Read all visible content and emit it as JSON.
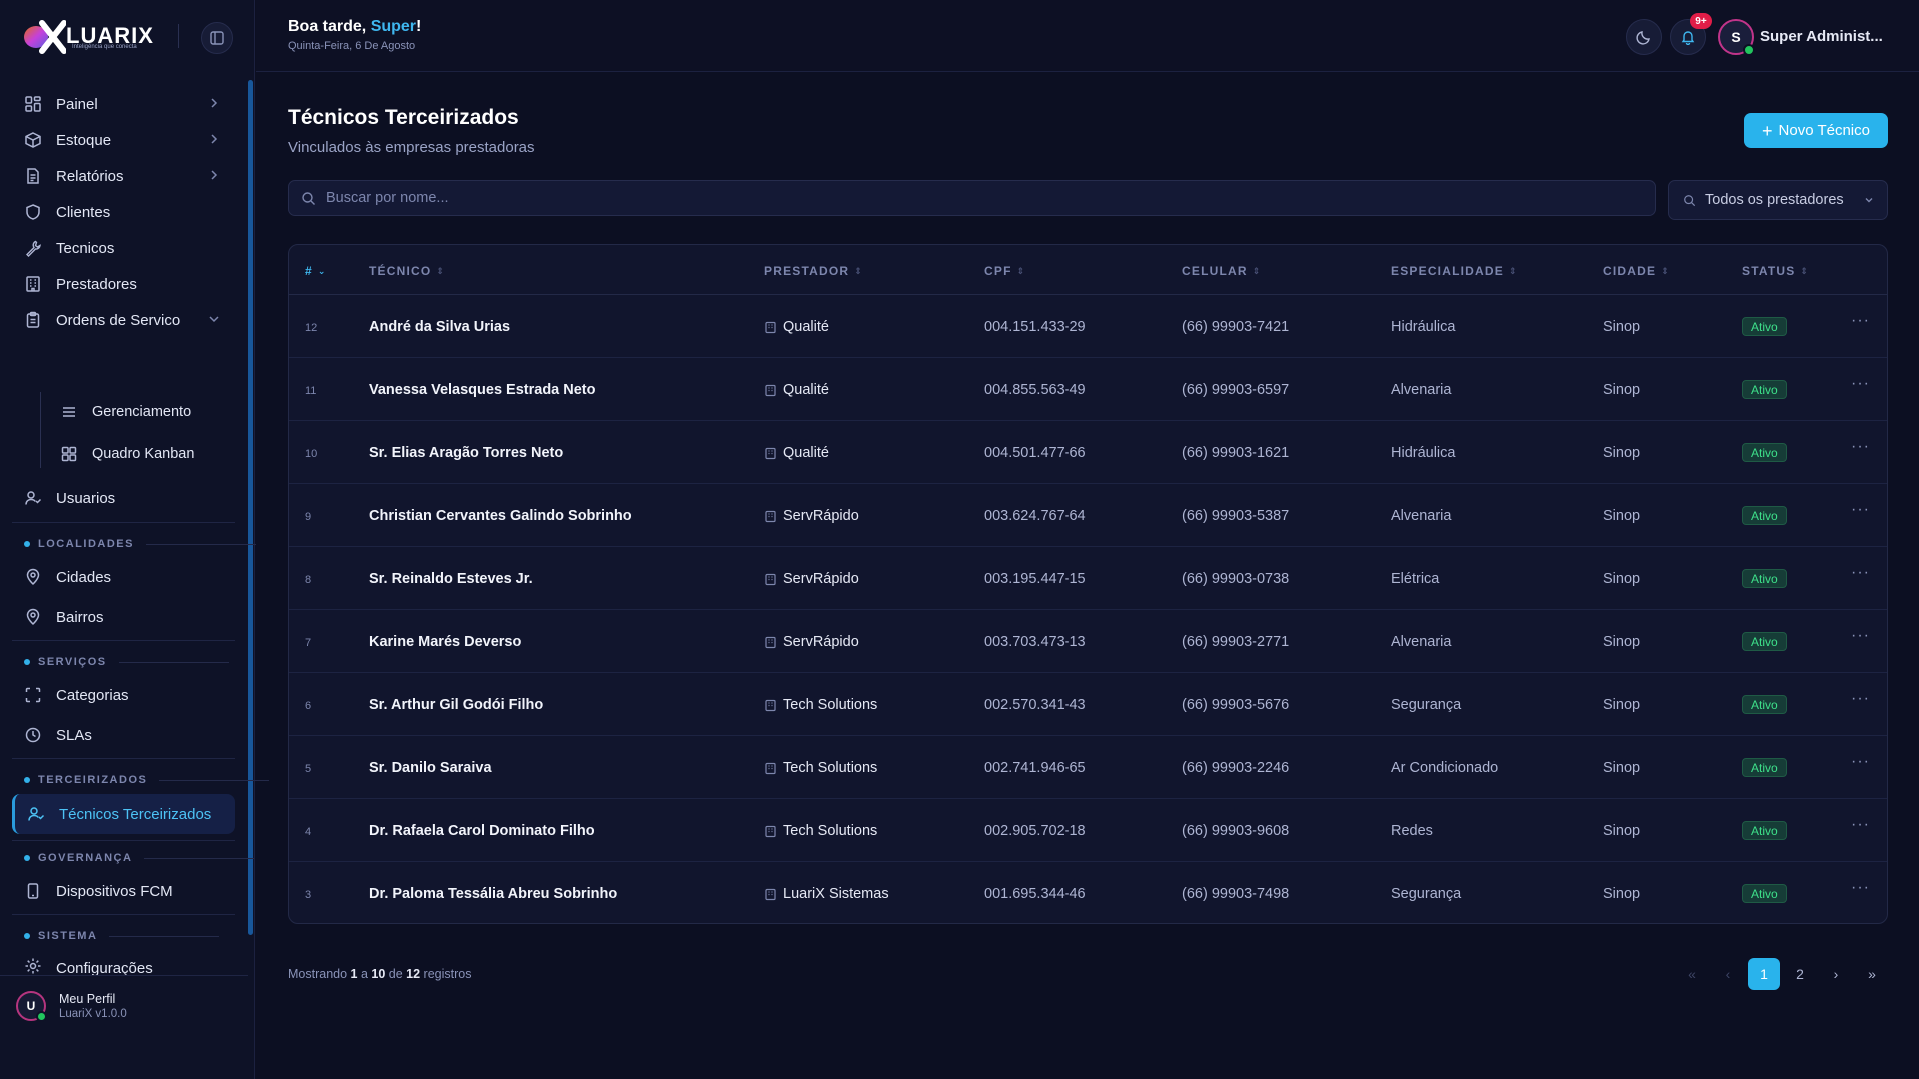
{
  "app": {
    "brand": "LUARIX",
    "tagline": "Inteligência que conecta"
  },
  "header": {
    "greeting_prefix": "Boa tarde, ",
    "greeting_name": "Super",
    "greeting_suffix": "!",
    "date": "Quinta-Feira, 6 De Agosto",
    "notification_badge": "9+",
    "user_initial": "S",
    "user_name": "Super Administ..."
  },
  "sidebar": {
    "items": {
      "painel": "Painel",
      "estoque": "Estoque",
      "relatorios": "Relatórios",
      "clientes": "Clientes",
      "tecnicos": "Tecnicos",
      "prestadores": "Prestadores",
      "ordens": "Ordens de Servico",
      "gerenciamento": "Gerenciamento",
      "kanban": "Quadro Kanban",
      "usuarios": "Usuarios",
      "cidades": "Cidades",
      "bairros": "Bairros",
      "categorias": "Categorias",
      "slas": "SLAs",
      "tecnicos_terceirizados": "Técnicos Terceirizados",
      "dispositivos": "Dispositivos FCM",
      "configuracoes": "Configurações"
    },
    "sections": {
      "localidades": "LOCALIDADES",
      "servicos": "SERVIÇOS",
      "terceirizados": "TERCEIRIZADOS",
      "governanca": "GOVERNANÇA",
      "sistema": "SISTEMA"
    },
    "profile": {
      "initial": "U",
      "name": "Meu Perfil",
      "version": "LuariX v1.0.0"
    }
  },
  "page": {
    "title": "Técnicos Terceirizados",
    "subtitle": "Vinculados às empresas prestadoras",
    "new_button": "Novo Técnico",
    "search_placeholder": "Buscar por nome...",
    "filter_label": "Todos os prestadores"
  },
  "table": {
    "headers": {
      "id": "#",
      "tecnico": "TÉCNICO",
      "prestador": "PRESTADOR",
      "cpf": "CPF",
      "celular": "CELULAR",
      "especialidade": "ESPECIALIDADE",
      "cidade": "CIDADE",
      "status": "STATUS"
    },
    "rows": [
      {
        "id": "12",
        "name": "André da Silva Urias",
        "prestador": "Qualité",
        "cpf": "004.151.433-29",
        "celular": "(66) 99903-7421",
        "especialidade": "Hidráulica",
        "cidade": "Sinop",
        "status": "Ativo"
      },
      {
        "id": "11",
        "name": "Vanessa Velasques Estrada Neto",
        "prestador": "Qualité",
        "cpf": "004.855.563-49",
        "celular": "(66) 99903-6597",
        "especialidade": "Alvenaria",
        "cidade": "Sinop",
        "status": "Ativo"
      },
      {
        "id": "10",
        "name": "Sr. Elias Aragão Torres Neto",
        "prestador": "Qualité",
        "cpf": "004.501.477-66",
        "celular": "(66) 99903-1621",
        "especialidade": "Hidráulica",
        "cidade": "Sinop",
        "status": "Ativo"
      },
      {
        "id": "9",
        "name": "Christian Cervantes Galindo Sobrinho",
        "prestador": "ServRápido",
        "cpf": "003.624.767-64",
        "celular": "(66) 99903-5387",
        "especialidade": "Alvenaria",
        "cidade": "Sinop",
        "status": "Ativo"
      },
      {
        "id": "8",
        "name": "Sr. Reinaldo Esteves Jr.",
        "prestador": "ServRápido",
        "cpf": "003.195.447-15",
        "celular": "(66) 99903-0738",
        "especialidade": "Elétrica",
        "cidade": "Sinop",
        "status": "Ativo"
      },
      {
        "id": "7",
        "name": "Karine Marés Deverso",
        "prestador": "ServRápido",
        "cpf": "003.703.473-13",
        "celular": "(66) 99903-2771",
        "especialidade": "Alvenaria",
        "cidade": "Sinop",
        "status": "Ativo"
      },
      {
        "id": "6",
        "name": "Sr. Arthur Gil Godói Filho",
        "prestador": "Tech Solutions",
        "cpf": "002.570.341-43",
        "celular": "(66) 99903-5676",
        "especialidade": "Segurança",
        "cidade": "Sinop",
        "status": "Ativo"
      },
      {
        "id": "5",
        "name": "Sr. Danilo Saraiva",
        "prestador": "Tech Solutions",
        "cpf": "002.741.946-65",
        "celular": "(66) 99903-2246",
        "especialidade": "Ar Condicionado",
        "cidade": "Sinop",
        "status": "Ativo"
      },
      {
        "id": "4",
        "name": "Dr. Rafaela Carol Dominato Filho",
        "prestador": "Tech Solutions",
        "cpf": "002.905.702-18",
        "celular": "(66) 99903-9608",
        "especialidade": "Redes",
        "cidade": "Sinop",
        "status": "Ativo"
      },
      {
        "id": "3",
        "name": "Dr. Paloma Tessália Abreu Sobrinho",
        "prestador": "LuariX Sistemas",
        "cpf": "001.695.344-46",
        "celular": "(66) 99903-7498",
        "especialidade": "Segurança",
        "cidade": "Sinop",
        "status": "Ativo"
      }
    ],
    "row_more": "···"
  },
  "pagination": {
    "showing_prefix": "Mostrando ",
    "from": "1",
    "mid1": " a ",
    "to": "10",
    "mid2": " de ",
    "total": "12",
    "suffix": " registros",
    "first": "«",
    "prev": "‹",
    "page1": "1",
    "page2": "2",
    "next": "›",
    "last": "»"
  },
  "colors": {
    "accent": "#29b3ec",
    "status_active": "#3ee08a",
    "badge": "#e11d48"
  }
}
